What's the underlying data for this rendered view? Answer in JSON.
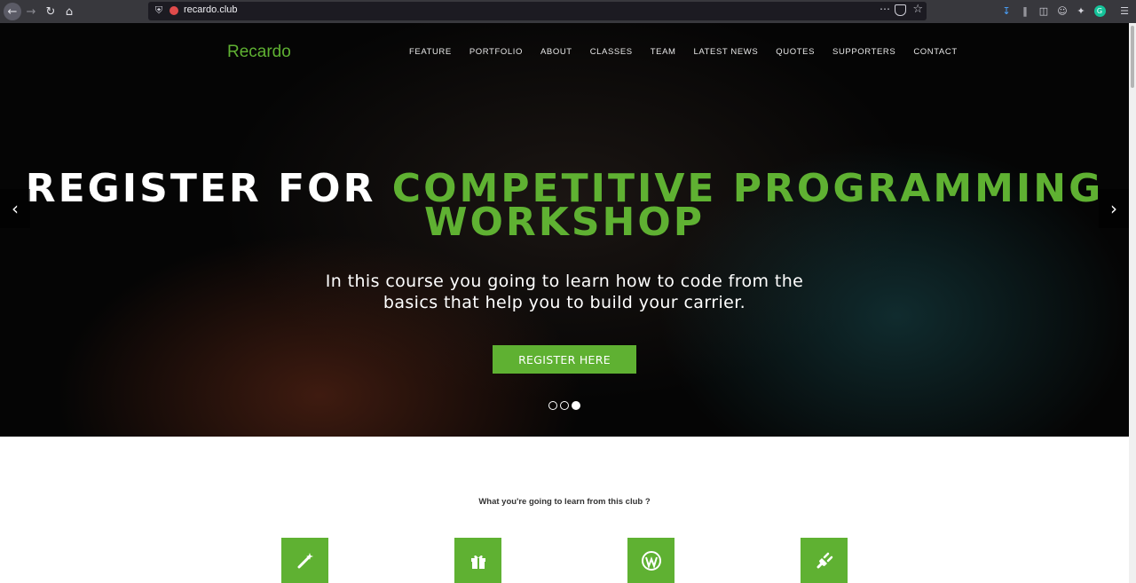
{
  "browser": {
    "url": "recardo.club",
    "icons": [
      "back-icon",
      "forward-icon",
      "reload-icon",
      "home-icon",
      "shield-icon",
      "page-actions-icon",
      "pocket-icon",
      "bookmark-star-icon",
      "download-icon",
      "library-icon",
      "sidebar-icon",
      "account-icon",
      "extension-icon",
      "grammarly-icon",
      "menu-icon"
    ]
  },
  "site": {
    "brand": "Recardo",
    "nav": [
      "FEATURE",
      "PORTFOLIO",
      "ABOUT",
      "CLASSES",
      "TEAM",
      "LATEST NEWS",
      "QUOTES",
      "SUPPORTERS",
      "CONTACT"
    ]
  },
  "hero": {
    "title_white": "REGISTER FOR",
    "title_green": "COMPETITIVE PROGRAMMING WORKSHOP",
    "subtitle_line1": "In this course you going to learn how to code from the",
    "subtitle_line2": "basics that help you to build your carrier.",
    "cta_label": "REGISTER HERE",
    "slide_count": 3,
    "active_slide": 3,
    "prev_arrow": "‹",
    "next_arrow": "›"
  },
  "features": {
    "title": "What you're going to learn from this club ?",
    "icons": [
      "magic-wand-icon",
      "gift-icon",
      "wordpress-icon",
      "plug-icon"
    ]
  },
  "colors": {
    "accent": "#5fb132",
    "chrome": "#38383d",
    "urlbar": "#1c1b22"
  }
}
